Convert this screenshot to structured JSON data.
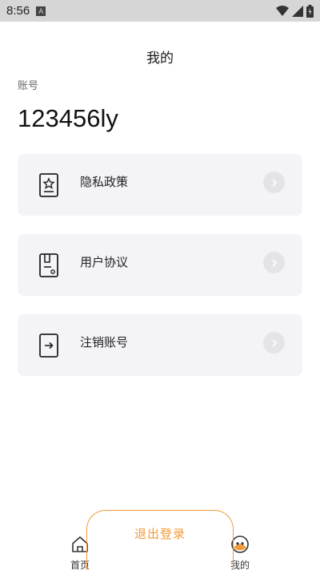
{
  "status_bar": {
    "time": "8:56",
    "badge": "A",
    "icons": [
      "wifi-icon",
      "signal-icon",
      "battery-icon"
    ]
  },
  "header": {
    "title": "我的"
  },
  "account": {
    "label": "账号",
    "value": "123456ly"
  },
  "menu": {
    "items": [
      {
        "label": "隐私政策",
        "icon": "privacy-policy-icon"
      },
      {
        "label": "用户协议",
        "icon": "user-agreement-icon"
      },
      {
        "label": "注销账号",
        "icon": "deactivate-account-icon"
      }
    ]
  },
  "logout": {
    "label": "退出登录"
  },
  "bottom_nav": {
    "items": [
      {
        "label": "首页",
        "icon": "home-icon"
      },
      {
        "label": "我的",
        "icon": "profile-icon"
      }
    ]
  },
  "colors": {
    "accent": "#f29b3a",
    "card_bg": "#f4f4f8"
  }
}
